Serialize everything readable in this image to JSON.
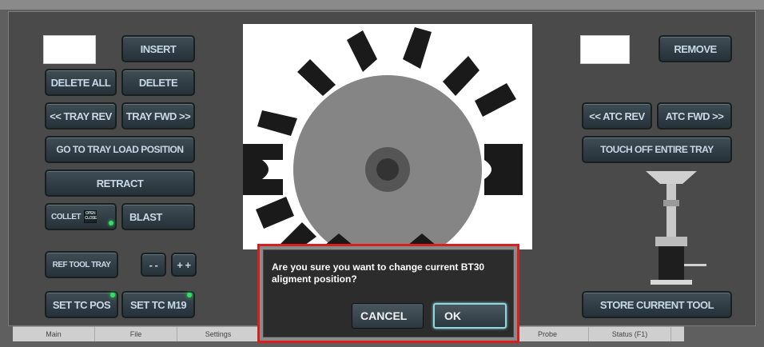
{
  "left_panel": {
    "insert_label": "INSERT",
    "delete_all_label": "DELETE ALL",
    "delete_label": "DELETE",
    "tray_rev_label": "<< TRAY REV",
    "tray_fwd_label": "TRAY FWD >>",
    "load_position_label": "GO TO TRAY LOAD POSITION",
    "retract_label": "RETRACT",
    "collet_label": "COLLET",
    "collet_open_label": "OPEN",
    "collet_close_label": "CLOSE",
    "blast_label": "BLAST",
    "ref_tool_tray_label": "REF TOOL TRAY",
    "minus_label": "- -",
    "plus_label": "+ +",
    "set_tc_pos_label": "SET TC POS",
    "set_tc_m19_label": "SET TC M19",
    "tool_number_value": ""
  },
  "right_panel": {
    "remove_label": "REMOVE",
    "atc_rev_label": "<< ATC REV",
    "atc_fwd_label": "ATC FWD >>",
    "touch_off_label": "TOUCH OFF ENTIRE TRAY",
    "store_current_label": "STORE CURRENT TOOL",
    "tool_number_value": ""
  },
  "dialog": {
    "message": "Are you sure you want to change current BT30 aligment position?",
    "cancel_label": "CANCEL",
    "ok_label": "OK"
  },
  "tabs": [
    "Main",
    "File",
    "Settings",
    "",
    "",
    "",
    "Probe",
    "Status (F1)"
  ],
  "colors": {
    "led_green": "#30e060",
    "dialog_highlight": "#d81e1e",
    "ok_focus": "#8fd7df"
  }
}
